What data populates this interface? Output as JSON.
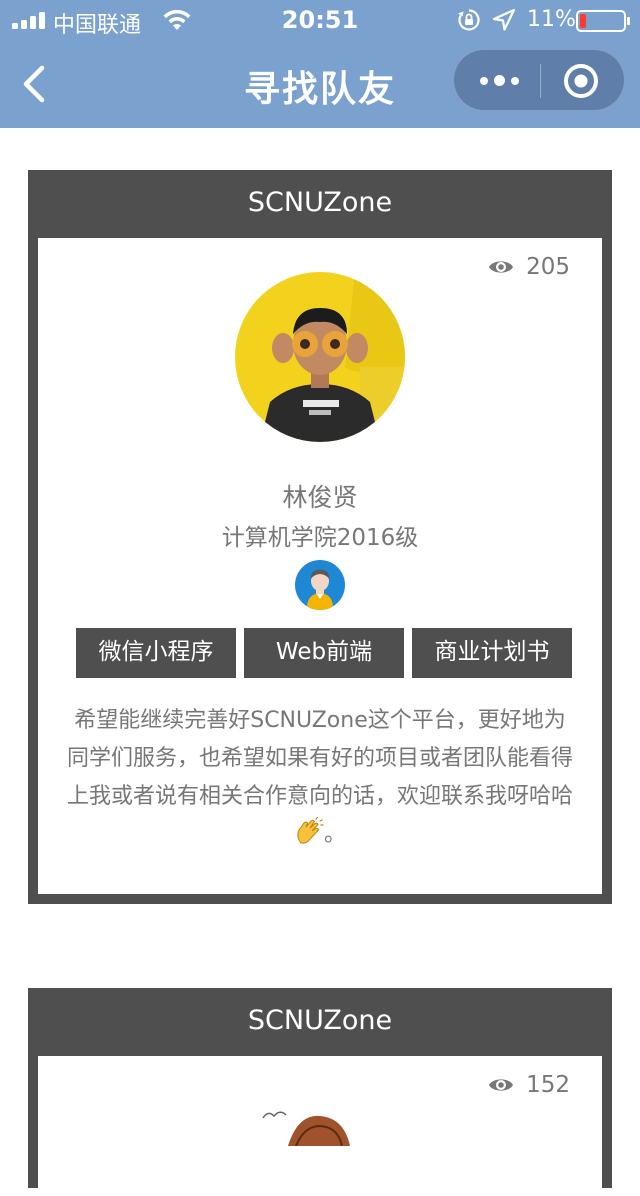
{
  "status_bar": {
    "carrier": "中国联通",
    "time": "20:51",
    "battery": "11%",
    "icons": [
      "signal-icon",
      "wifi-icon",
      "rotation-lock-icon",
      "location-arrow-icon",
      "battery-icon"
    ]
  },
  "nav": {
    "title": "寻找队友",
    "back_icon": "chevron-left-icon",
    "more_icon": "more-dots-icon",
    "close_icon": "miniprogram-close-icon"
  },
  "colors": {
    "nav_bg": "#7ba1cf",
    "card_bg": "#4f4f4f",
    "text_gray": "#777777",
    "gender_badge": "#1e88d4"
  },
  "cards": [
    {
      "header": "SCNUZone",
      "views": "205",
      "name": "林俊贤",
      "college": "计算机学院2016级",
      "tags": [
        "微信小程序",
        "Web前端",
        "商业计划书"
      ],
      "intro_text": "希望能继续完善好SCNUZone这个平台，更好地为同学们服务，也希望如果有好的项目或者团队能看得上我或者说有相关合作意向的话，欢迎联系我呀哈哈",
      "intro_end": "。"
    },
    {
      "header": "SCNUZone",
      "views": "152"
    }
  ]
}
